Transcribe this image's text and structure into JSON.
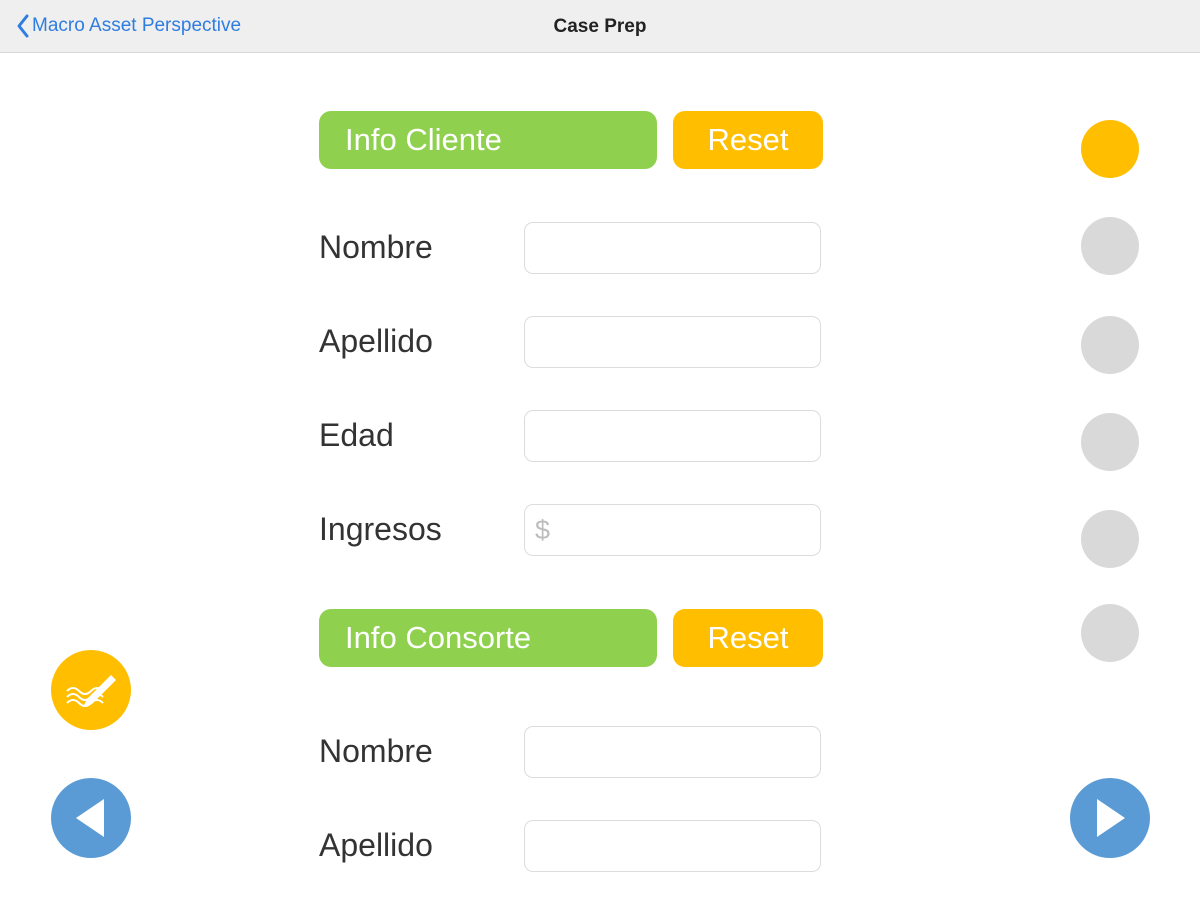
{
  "nav": {
    "back_label": "Macro Asset Perspective",
    "title": "Case Prep"
  },
  "cliente": {
    "header": "Info Cliente",
    "reset_label": "Reset",
    "fields": [
      {
        "label": "Nombre",
        "value": "",
        "placeholder": ""
      },
      {
        "label": "Apellido",
        "value": "",
        "placeholder": ""
      },
      {
        "label": "Edad",
        "value": "",
        "placeholder": ""
      },
      {
        "label": "Ingresos",
        "value": "",
        "placeholder": "$"
      }
    ]
  },
  "consorte": {
    "header": "Info Consorte",
    "reset_label": "Reset",
    "fields": [
      {
        "label": "Nombre",
        "value": "",
        "placeholder": ""
      },
      {
        "label": "Apellido",
        "value": "",
        "placeholder": ""
      }
    ]
  },
  "steps": {
    "count": 6,
    "active_index": 0
  },
  "icons": {
    "back": "chevron-left-icon",
    "sign": "signature-pen-icon",
    "prev": "triangle-left-icon",
    "next": "triangle-right-icon"
  },
  "colors": {
    "accent_green": "#8fd14f",
    "accent_yellow": "#ffbe00",
    "nav_blue": "#5b9bd5",
    "link_blue": "#2f7de1",
    "inactive_dot": "#d9d9d9"
  }
}
